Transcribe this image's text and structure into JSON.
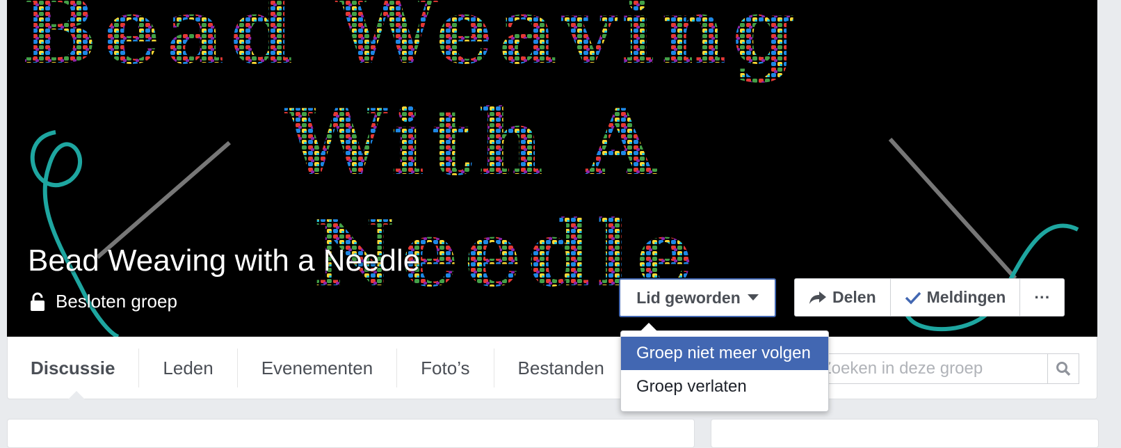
{
  "group": {
    "title": "Bead Weaving with a Needle",
    "privacy": "Besloten groep"
  },
  "actions": {
    "joined_label": "Lid geworden",
    "share_label": "Delen",
    "notifications_label": "Meldingen",
    "more_label": "···"
  },
  "dropdown": {
    "items": [
      {
        "label": "Groep niet meer volgen",
        "selected": true
      },
      {
        "label": "Groep verlaten",
        "selected": false
      }
    ]
  },
  "tabs": [
    {
      "label": "Discussie",
      "active": true
    },
    {
      "label": "Leden",
      "active": false
    },
    {
      "label": "Evenementen",
      "active": false
    },
    {
      "label": "Foto’s",
      "active": false
    },
    {
      "label": "Bestanden",
      "active": false
    }
  ],
  "search": {
    "placeholder": "Zoeken in deze groep"
  },
  "colors": {
    "accent": "#4267b2",
    "cover_bg": "#000000",
    "page_bg": "#e9ebee"
  }
}
